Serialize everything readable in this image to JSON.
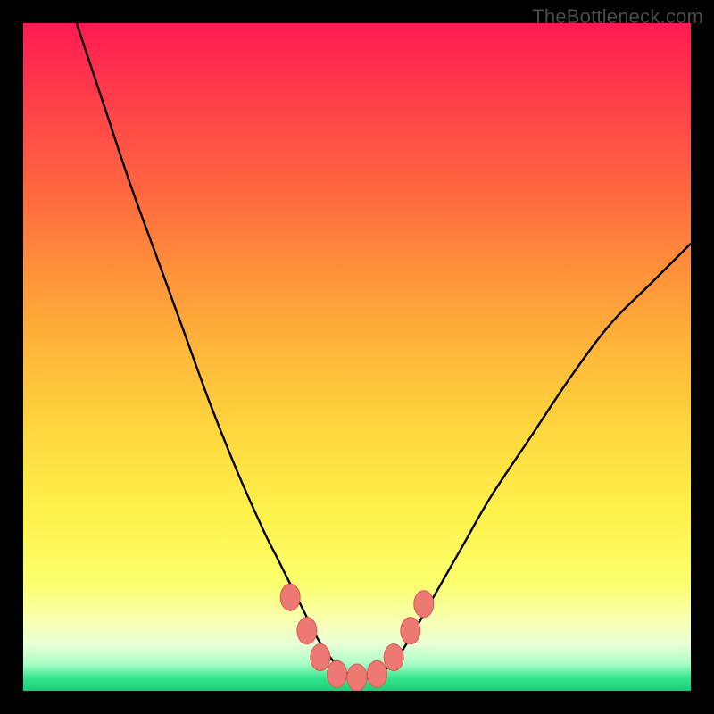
{
  "watermark": "TheBottleneck.com",
  "colors": {
    "background": "#000000",
    "curve_stroke": "#000000",
    "marker_fill": "#ec7a72",
    "marker_stroke": "#d85a52"
  },
  "chart_data": {
    "type": "line",
    "title": "",
    "xlabel": "",
    "ylabel": "",
    "xlim": [
      0,
      100
    ],
    "ylim": [
      0,
      100
    ],
    "series": [
      {
        "name": "curve",
        "x": [
          8,
          12,
          16,
          20,
          24,
          28,
          32,
          36,
          38,
          40,
          42,
          44,
          46,
          48,
          50,
          52,
          54,
          56,
          58,
          62,
          66,
          70,
          76,
          82,
          88,
          94,
          100
        ],
        "y": [
          100,
          88,
          76,
          65,
          54,
          43,
          33,
          24,
          20,
          16,
          12,
          8,
          5,
          3,
          2,
          2,
          3,
          5,
          8,
          15,
          22,
          29,
          38,
          47,
          55,
          61,
          67
        ]
      }
    ],
    "markers": [
      {
        "x": 40.0,
        "y": 14
      },
      {
        "x": 42.5,
        "y": 9
      },
      {
        "x": 44.5,
        "y": 5
      },
      {
        "x": 47.0,
        "y": 2.5
      },
      {
        "x": 50.0,
        "y": 2
      },
      {
        "x": 53.0,
        "y": 2.5
      },
      {
        "x": 55.5,
        "y": 5
      },
      {
        "x": 58.0,
        "y": 9
      },
      {
        "x": 60.0,
        "y": 13
      }
    ]
  }
}
